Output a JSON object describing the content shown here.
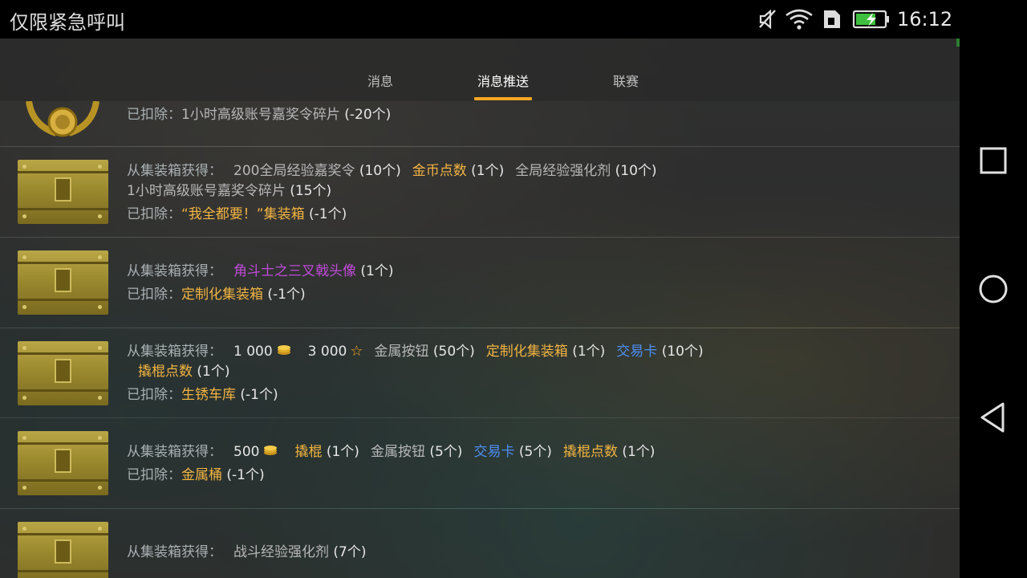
{
  "status_bar": {
    "carrier": "仅限紧急呼叫",
    "time": "16:12",
    "icons": [
      "mute-icon",
      "wifi-icon",
      "sim-icon",
      "battery-charging-icon"
    ]
  },
  "nav_bar": {
    "icons": [
      "recents-square-icon",
      "home-circle-icon",
      "back-triangle-icon"
    ]
  },
  "tabs": [
    {
      "label": "消息",
      "active": false
    },
    {
      "label": "消息推送",
      "active": true
    },
    {
      "label": "联赛",
      "active": false
    }
  ],
  "colors": {
    "accent": "#f5a623",
    "orange_item": "#f2b441",
    "purple_item": "#c04ad8",
    "blue_item": "#4d8ef2",
    "label_gray": "#a9b0b3"
  },
  "rows": [
    {
      "deducted_label": "已扣除：",
      "deducted_item": "1小时高级账号嘉奖令碎片",
      "deducted_count": "(-20个)"
    },
    {
      "gain_label": "从集装箱获得：",
      "i1": "200全局经验嘉奖令",
      "c1": "(10个)",
      "i2": "金币点数",
      "c2": "(1个)",
      "i3": "全局经验强化剂",
      "c3": "(10个)",
      "i4": "1小时高级账号嘉奖令碎片",
      "c4": "(15个)",
      "deducted_label": "已扣除：",
      "deducted_item": "“我全都要！”集装箱",
      "deducted_count": "(-1个)"
    },
    {
      "gain_label": "从集装箱获得：",
      "i1": "角斗士之三叉戟头像",
      "c1": "(1个)",
      "deducted_label": "已扣除：",
      "deducted_item": "定制化集装箱",
      "deducted_count": "(-1个)"
    },
    {
      "gain_label": "从集装箱获得：",
      "credits": "1 000",
      "gold": "3 000",
      "i1": "金属按钮",
      "c1": "(50个)",
      "i2": "定制化集装箱",
      "c2": "(1个)",
      "i3": "交易卡",
      "c3": "(10个)",
      "i4": "撬棍点数",
      "c4": "(1个)",
      "deducted_label": "已扣除：",
      "deducted_item": "生锈车库",
      "deducted_count": "(-1个)"
    },
    {
      "gain_label": "从集装箱获得：",
      "credits": "500",
      "i1": "撬棍",
      "c1": "(1个)",
      "i2": "金属按钮",
      "c2": "(5个)",
      "i3": "交易卡",
      "c3": "(5个)",
      "i4": "撬棍点数",
      "c4": "(1个)",
      "deducted_label": "已扣除：",
      "deducted_item": "金属桶",
      "deducted_count": "(-1个)"
    },
    {
      "gain_label": "从集装箱获得：",
      "i1": "战斗经验强化剂",
      "c1": "(7个)"
    }
  ]
}
